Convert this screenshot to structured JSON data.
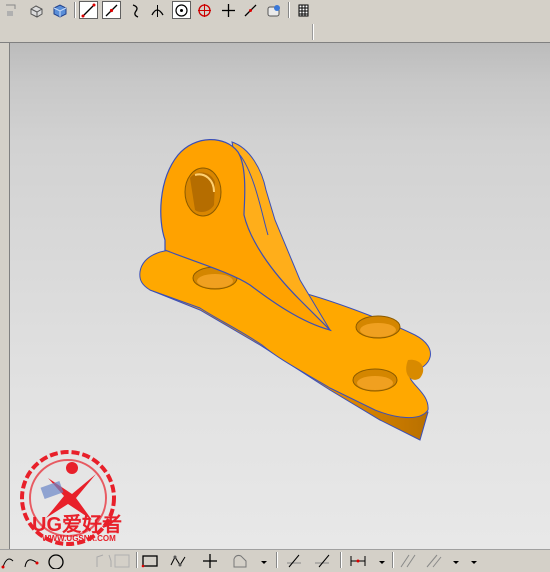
{
  "toolbar_top": {
    "buttons": [
      {
        "name": "shaded-view-icon"
      },
      {
        "name": "cube-view-icon"
      },
      {
        "name": "line-icon"
      },
      {
        "name": "line-point-icon"
      },
      {
        "name": "arc-icon"
      },
      {
        "name": "arc-tangent-icon"
      },
      {
        "name": "circle-center-icon"
      },
      {
        "name": "circle-point-icon"
      },
      {
        "name": "crosshair-icon"
      },
      {
        "name": "diagonal-line-icon"
      },
      {
        "name": "hole-icon"
      },
      {
        "name": "grid-icon"
      }
    ]
  },
  "logo": {
    "text": "UG爱好者",
    "url": "WWW.UGSNX.COM"
  },
  "colors": {
    "part": "#ffa500",
    "part_dark": "#e08800",
    "part_edge": "#3a4fb8",
    "logo_red": "#e8202a"
  }
}
